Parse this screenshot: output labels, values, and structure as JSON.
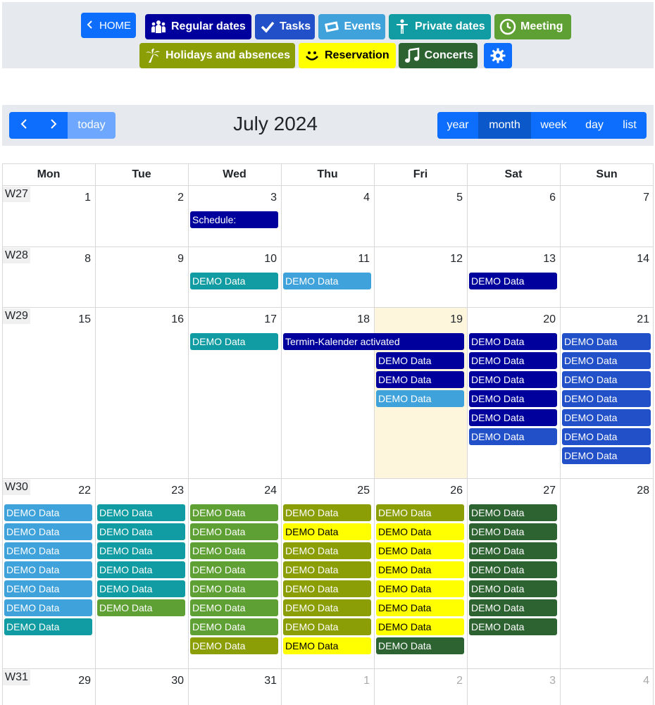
{
  "nav": {
    "home_label": "HOME",
    "regular_label": "Regular dates",
    "tasks_label": "Tasks",
    "events_label": "Events",
    "private_label": "Private dates",
    "meeting_label": "Meeting",
    "holidays_label": "Holidays and absences",
    "reservation_label": "Reservation",
    "concerts_label": "Concerts"
  },
  "toolbar": {
    "today_label": "today",
    "title": "July 2024",
    "views": {
      "year": "year",
      "month": "month",
      "week": "week",
      "day": "day",
      "list": "list"
    },
    "active_view": "month"
  },
  "weekdays": [
    "Mon",
    "Tue",
    "Wed",
    "Thu",
    "Fri",
    "Sat",
    "Sun"
  ],
  "weeks": [
    {
      "label": "W27",
      "days": [
        "1",
        "2",
        "3",
        "4",
        "5",
        "6",
        "7"
      ],
      "other": []
    },
    {
      "label": "W28",
      "days": [
        "8",
        "9",
        "10",
        "11",
        "12",
        "13",
        "14"
      ],
      "other": []
    },
    {
      "label": "W29",
      "days": [
        "15",
        "16",
        "17",
        "18",
        "19",
        "20",
        "21"
      ],
      "other": []
    },
    {
      "label": "W30",
      "days": [
        "22",
        "23",
        "24",
        "25",
        "26",
        "27",
        "28"
      ],
      "other": []
    },
    {
      "label": "W31",
      "days": [
        "29",
        "30",
        "31",
        "1",
        "2",
        "3",
        "4"
      ],
      "other": [
        3,
        4,
        5,
        6
      ]
    }
  ],
  "today": {
    "week": 2,
    "day": 4
  },
  "colors": {
    "navy": "#00009d",
    "teal": "#109ca2",
    "skyblue": "#3fa2db",
    "royal": "#2250c8",
    "green": "#5ea033",
    "olive": "#8c9e05",
    "yellow": "#ffff00",
    "darkgreen": "#2d6331",
    "primary": "#0d6efd",
    "primary_dark": "#0a58ca"
  },
  "events": [
    {
      "text": "Schedule:",
      "week": 0,
      "day": 2,
      "span": 1,
      "row": 0,
      "color": "navy"
    },
    {
      "text": "DEMO Data",
      "week": 1,
      "day": 2,
      "span": 1,
      "row": 0,
      "color": "teal"
    },
    {
      "text": "DEMO Data",
      "week": 1,
      "day": 3,
      "span": 1,
      "row": 0,
      "color": "skyblue"
    },
    {
      "text": "DEMO Data",
      "week": 1,
      "day": 5,
      "span": 1,
      "row": 0,
      "color": "navy"
    },
    {
      "text": "DEMO Data",
      "week": 2,
      "day": 2,
      "span": 1,
      "row": 0,
      "color": "teal"
    },
    {
      "text": "Termin-Kalender activated",
      "week": 2,
      "day": 3,
      "span": 2,
      "row": 0,
      "color": "navy"
    },
    {
      "text": "DEMO Data",
      "week": 2,
      "day": 4,
      "span": 1,
      "row": 1,
      "color": "navy"
    },
    {
      "text": "DEMO Data",
      "week": 2,
      "day": 4,
      "span": 1,
      "row": 2,
      "color": "navy"
    },
    {
      "text": "DEMO Data",
      "week": 2,
      "day": 4,
      "span": 1,
      "row": 3,
      "color": "skyblue"
    },
    {
      "text": "DEMO Data",
      "week": 2,
      "day": 5,
      "span": 1,
      "row": 0,
      "color": "navy"
    },
    {
      "text": "DEMO Data",
      "week": 2,
      "day": 5,
      "span": 1,
      "row": 1,
      "color": "navy"
    },
    {
      "text": "DEMO Data",
      "week": 2,
      "day": 5,
      "span": 1,
      "row": 2,
      "color": "navy"
    },
    {
      "text": "DEMO Data",
      "week": 2,
      "day": 5,
      "span": 1,
      "row": 3,
      "color": "navy"
    },
    {
      "text": "DEMO Data",
      "week": 2,
      "day": 5,
      "span": 1,
      "row": 4,
      "color": "navy"
    },
    {
      "text": "DEMO Data",
      "week": 2,
      "day": 5,
      "span": 1,
      "row": 5,
      "color": "royal"
    },
    {
      "text": "DEMO Data",
      "week": 2,
      "day": 6,
      "span": 1,
      "row": 0,
      "color": "royal"
    },
    {
      "text": "DEMO Data",
      "week": 2,
      "day": 6,
      "span": 1,
      "row": 1,
      "color": "royal"
    },
    {
      "text": "DEMO Data",
      "week": 2,
      "day": 6,
      "span": 1,
      "row": 2,
      "color": "royal"
    },
    {
      "text": "DEMO Data",
      "week": 2,
      "day": 6,
      "span": 1,
      "row": 3,
      "color": "royal"
    },
    {
      "text": "DEMO Data",
      "week": 2,
      "day": 6,
      "span": 1,
      "row": 4,
      "color": "royal"
    },
    {
      "text": "DEMO Data",
      "week": 2,
      "day": 6,
      "span": 1,
      "row": 5,
      "color": "royal"
    },
    {
      "text": "DEMO Data",
      "week": 2,
      "day": 6,
      "span": 1,
      "row": 6,
      "color": "royal"
    },
    {
      "text": "DEMO Data",
      "week": 3,
      "day": 0,
      "span": 1,
      "row": 0,
      "color": "skyblue"
    },
    {
      "text": "DEMO Data",
      "week": 3,
      "day": 0,
      "span": 1,
      "row": 1,
      "color": "skyblue"
    },
    {
      "text": "DEMO Data",
      "week": 3,
      "day": 0,
      "span": 1,
      "row": 2,
      "color": "skyblue"
    },
    {
      "text": "DEMO Data",
      "week": 3,
      "day": 0,
      "span": 1,
      "row": 3,
      "color": "skyblue"
    },
    {
      "text": "DEMO Data",
      "week": 3,
      "day": 0,
      "span": 1,
      "row": 4,
      "color": "skyblue"
    },
    {
      "text": "DEMO Data",
      "week": 3,
      "day": 0,
      "span": 1,
      "row": 5,
      "color": "skyblue"
    },
    {
      "text": "DEMO Data",
      "week": 3,
      "day": 0,
      "span": 1,
      "row": 6,
      "color": "teal"
    },
    {
      "text": "DEMO Data",
      "week": 3,
      "day": 1,
      "span": 1,
      "row": 0,
      "color": "teal"
    },
    {
      "text": "DEMO Data",
      "week": 3,
      "day": 1,
      "span": 1,
      "row": 1,
      "color": "teal"
    },
    {
      "text": "DEMO Data",
      "week": 3,
      "day": 1,
      "span": 1,
      "row": 2,
      "color": "teal"
    },
    {
      "text": "DEMO Data",
      "week": 3,
      "day": 1,
      "span": 1,
      "row": 3,
      "color": "teal"
    },
    {
      "text": "DEMO Data",
      "week": 3,
      "day": 1,
      "span": 1,
      "row": 4,
      "color": "teal"
    },
    {
      "text": "DEMO Data",
      "week": 3,
      "day": 1,
      "span": 1,
      "row": 5,
      "color": "green"
    },
    {
      "text": "DEMO Data",
      "week": 3,
      "day": 2,
      "span": 1,
      "row": 0,
      "color": "green"
    },
    {
      "text": "DEMO Data",
      "week": 3,
      "day": 2,
      "span": 1,
      "row": 1,
      "color": "green"
    },
    {
      "text": "DEMO Data",
      "week": 3,
      "day": 2,
      "span": 1,
      "row": 2,
      "color": "green"
    },
    {
      "text": "DEMO Data",
      "week": 3,
      "day": 2,
      "span": 1,
      "row": 3,
      "color": "green"
    },
    {
      "text": "DEMO Data",
      "week": 3,
      "day": 2,
      "span": 1,
      "row": 4,
      "color": "green"
    },
    {
      "text": "DEMO Data",
      "week": 3,
      "day": 2,
      "span": 1,
      "row": 5,
      "color": "green"
    },
    {
      "text": "DEMO Data",
      "week": 3,
      "day": 2,
      "span": 1,
      "row": 6,
      "color": "green"
    },
    {
      "text": "DEMO Data",
      "week": 3,
      "day": 2,
      "span": 1,
      "row": 7,
      "color": "olive"
    },
    {
      "text": "DEMO Data",
      "week": 3,
      "day": 3,
      "span": 1,
      "row": 0,
      "color": "olive"
    },
    {
      "text": "DEMO Data",
      "week": 3,
      "day": 3,
      "span": 1,
      "row": 1,
      "color": "yellow"
    },
    {
      "text": "DEMO Data",
      "week": 3,
      "day": 3,
      "span": 1,
      "row": 2,
      "color": "olive"
    },
    {
      "text": "DEMO Data",
      "week": 3,
      "day": 3,
      "span": 1,
      "row": 3,
      "color": "olive"
    },
    {
      "text": "DEMO Data",
      "week": 3,
      "day": 3,
      "span": 1,
      "row": 4,
      "color": "olive"
    },
    {
      "text": "DEMO Data",
      "week": 3,
      "day": 3,
      "span": 1,
      "row": 5,
      "color": "olive"
    },
    {
      "text": "DEMO Data",
      "week": 3,
      "day": 3,
      "span": 1,
      "row": 6,
      "color": "olive"
    },
    {
      "text": "DEMO Data",
      "week": 3,
      "day": 3,
      "span": 1,
      "row": 7,
      "color": "yellow"
    },
    {
      "text": "DEMO Data",
      "week": 3,
      "day": 4,
      "span": 1,
      "row": 0,
      "color": "olive"
    },
    {
      "text": "DEMO Data",
      "week": 3,
      "day": 4,
      "span": 1,
      "row": 1,
      "color": "yellow"
    },
    {
      "text": "DEMO Data",
      "week": 3,
      "day": 4,
      "span": 1,
      "row": 2,
      "color": "yellow"
    },
    {
      "text": "DEMO Data",
      "week": 3,
      "day": 4,
      "span": 1,
      "row": 3,
      "color": "yellow"
    },
    {
      "text": "DEMO Data",
      "week": 3,
      "day": 4,
      "span": 1,
      "row": 4,
      "color": "yellow"
    },
    {
      "text": "DEMO Data",
      "week": 3,
      "day": 4,
      "span": 1,
      "row": 5,
      "color": "yellow"
    },
    {
      "text": "DEMO Data",
      "week": 3,
      "day": 4,
      "span": 1,
      "row": 6,
      "color": "yellow"
    },
    {
      "text": "DEMO Data",
      "week": 3,
      "day": 4,
      "span": 1,
      "row": 7,
      "color": "darkgreen"
    },
    {
      "text": "DEMO Data",
      "week": 3,
      "day": 5,
      "span": 1,
      "row": 0,
      "color": "darkgreen"
    },
    {
      "text": "DEMO Data",
      "week": 3,
      "day": 5,
      "span": 1,
      "row": 1,
      "color": "darkgreen"
    },
    {
      "text": "DEMO Data",
      "week": 3,
      "day": 5,
      "span": 1,
      "row": 2,
      "color": "darkgreen"
    },
    {
      "text": "DEMO Data",
      "week": 3,
      "day": 5,
      "span": 1,
      "row": 3,
      "color": "darkgreen"
    },
    {
      "text": "DEMO Data",
      "week": 3,
      "day": 5,
      "span": 1,
      "row": 4,
      "color": "darkgreen"
    },
    {
      "text": "DEMO Data",
      "week": 3,
      "day": 5,
      "span": 1,
      "row": 5,
      "color": "darkgreen"
    },
    {
      "text": "DEMO Data",
      "week": 3,
      "day": 5,
      "span": 1,
      "row": 6,
      "color": "darkgreen"
    }
  ]
}
